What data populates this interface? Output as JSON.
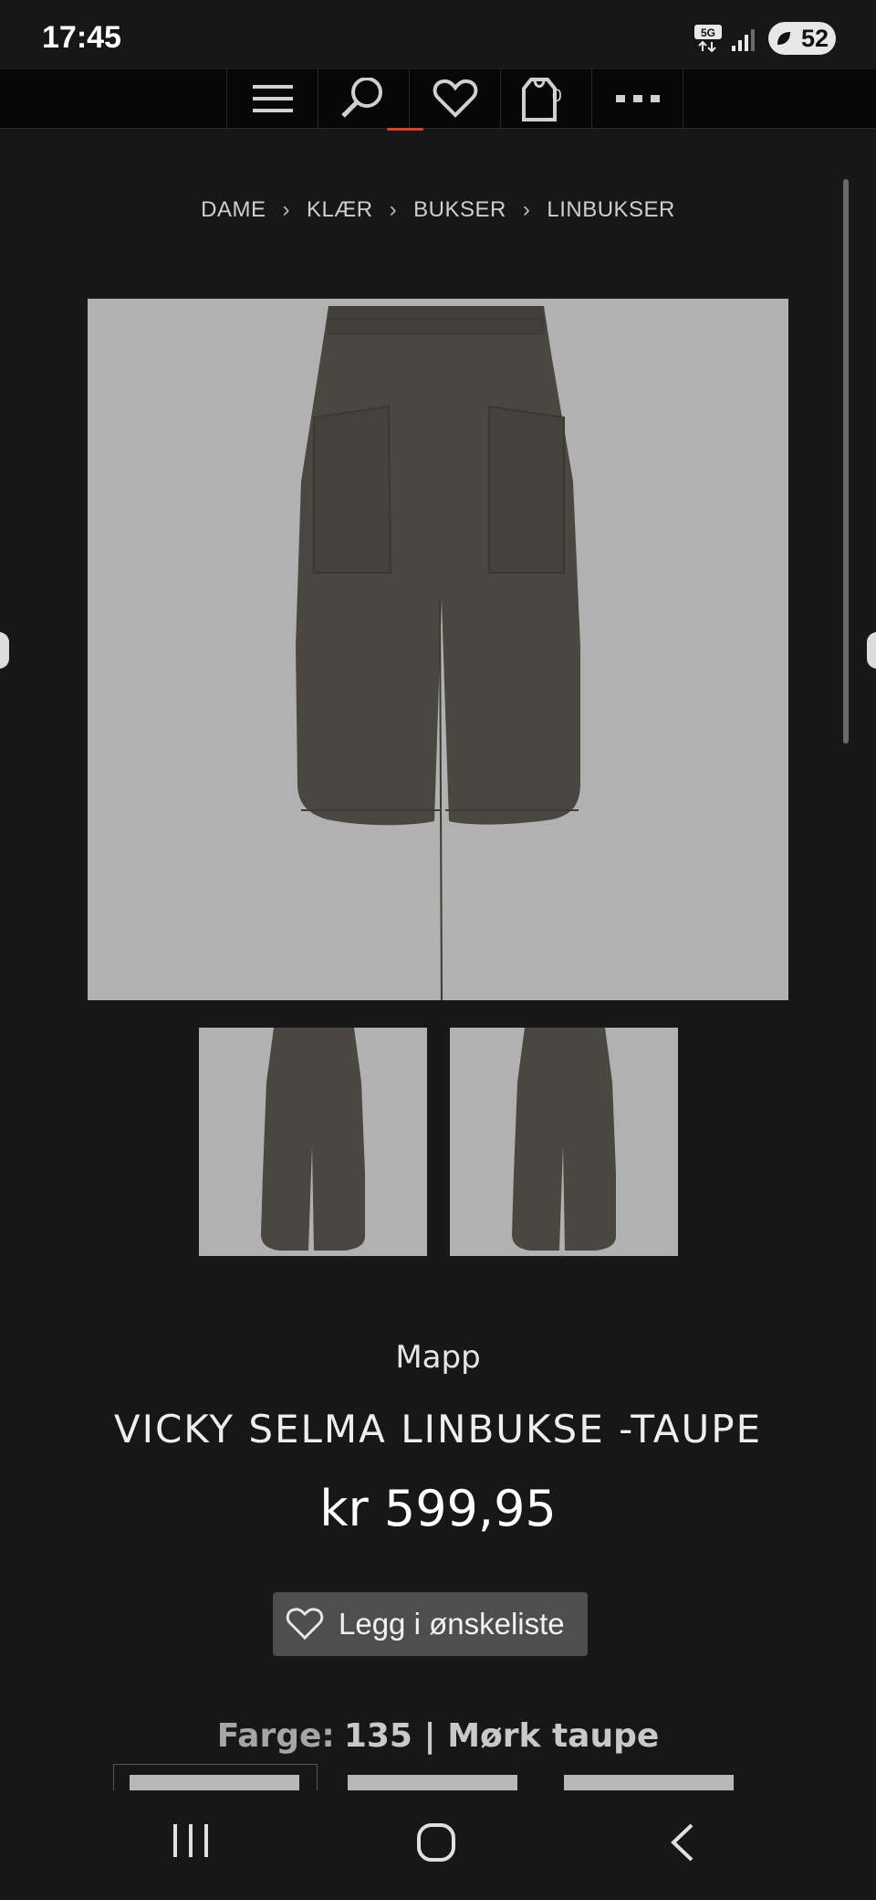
{
  "status_bar": {
    "time": "17:45",
    "network": "5G",
    "battery": "52"
  },
  "top_nav": {
    "cart_count": "0",
    "icons": [
      "menu-icon",
      "search-icon",
      "heart-icon",
      "cart-icon",
      "more-icon"
    ],
    "accent_color": "#c9472a"
  },
  "breadcrumb": [
    "DAME",
    "KLÆR",
    "BUKSER",
    "LINBUKSER"
  ],
  "product": {
    "brand": "Mapp",
    "title": "VICKY SELMA LINBUKSE -TAUPE",
    "price": "kr 599,95",
    "wishlist_label": "Legg i ønskeliste",
    "color_label": "Farge:",
    "color_value": "135 | Mørk taupe",
    "garment_color": "#4a4741",
    "image_bg": "#b1b1b1"
  },
  "android_nav": {
    "icons": [
      "recent-apps-icon",
      "home-icon",
      "back-icon"
    ]
  }
}
